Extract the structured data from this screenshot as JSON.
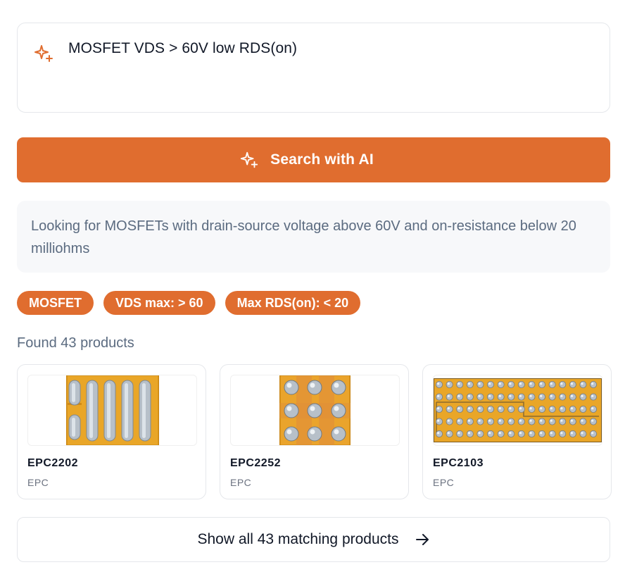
{
  "query": {
    "icon": "sparkles-icon",
    "text": "MOSFET VDS > 60V low RDS(on)"
  },
  "search_button": {
    "icon": "sparkles-icon",
    "label": "Search with AI"
  },
  "summary": {
    "text": "Looking for MOSFETs with drain-source voltage above 60V and on-resistance below 20 milliohms"
  },
  "filters": [
    {
      "label": "MOSFET"
    },
    {
      "label": "VDS max: > 60"
    },
    {
      "label": "Max RDS(on): < 20"
    }
  ],
  "results": {
    "count_text": "Found 43 products",
    "products": [
      {
        "name": "EPC2202",
        "brand": "EPC",
        "image": "chip-bars-image"
      },
      {
        "name": "EPC2252",
        "brand": "EPC",
        "image": "chip-bumps-3x3-image"
      },
      {
        "name": "EPC2103",
        "brand": "EPC",
        "image": "chip-bump-grid-image"
      }
    ]
  },
  "show_all": {
    "label": "Show all 43 matching products",
    "icon": "arrow-right-icon"
  },
  "colors": {
    "accent": "#e06d2f",
    "chip_gold": "#e9a628",
    "muted_text": "#5b6b80",
    "border": "#e5e7eb",
    "summary_bg": "#f7f8fa"
  }
}
